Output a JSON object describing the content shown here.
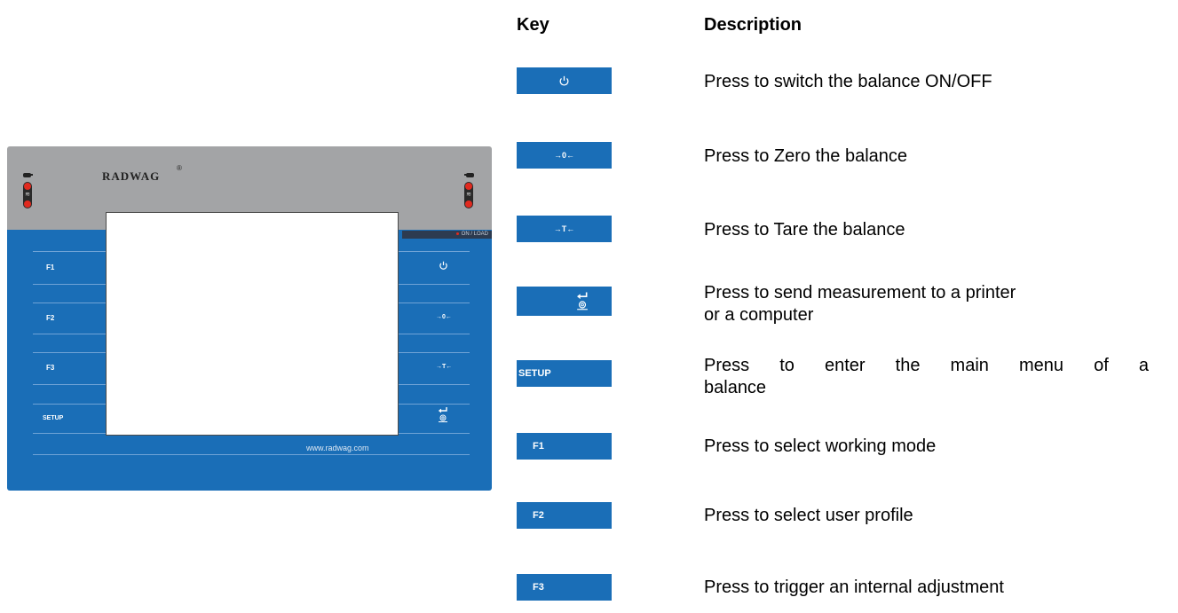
{
  "table": {
    "headers": {
      "key": "Key",
      "description": "Description"
    },
    "rows": [
      {
        "icon": "power-icon",
        "description": "Press to switch the balance ON/OFF"
      },
      {
        "key_text": "→0←",
        "description": "Press to Zero the balance"
      },
      {
        "key_text": "→T←",
        "description": "Press to Tare the balance"
      },
      {
        "icon": "print-enter-icon",
        "description_lines": [
          "Press to send measurement to a printer",
          "or a computer"
        ]
      },
      {
        "key_text": "SETUP",
        "description_lines": [
          "Press to enter the main menu of a",
          "balance"
        ]
      },
      {
        "key_text": "F1",
        "description": "Press to select working mode"
      },
      {
        "key_text": "F2",
        "description": "Press to select user profile"
      },
      {
        "key_text": "F3",
        "description": "Press to trigger an internal adjustment"
      }
    ]
  },
  "panel": {
    "logo_text": "RADWAG",
    "logo_mark": "®",
    "status_label": "ON / LOAD",
    "left_keys": [
      "F1",
      "F2",
      "F3",
      "SETUP"
    ],
    "right_keys": [
      "power-icon",
      "→0←",
      "→T←",
      "print-enter-icon"
    ],
    "website": "www.radwag.com"
  },
  "colors": {
    "panel_blue": "#1a6eb7",
    "panel_grey": "#a3a4a6",
    "led_red": "#e12a1f"
  }
}
